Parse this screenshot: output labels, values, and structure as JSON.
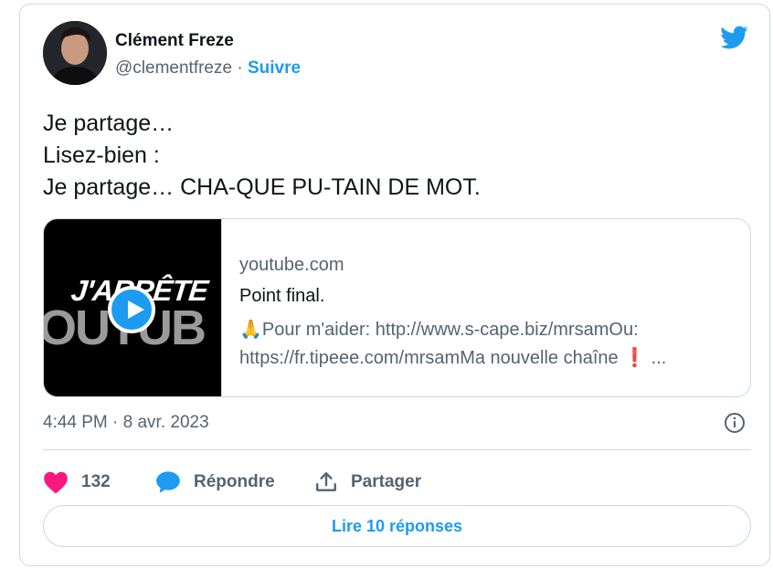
{
  "author": {
    "name": "Clément Freze",
    "handle": "@clementfreze",
    "separator": " · ",
    "follow_label": "Suivre"
  },
  "tweet": {
    "lines": [
      "Je partage…",
      "Lisez-bien :",
      "Je partage… CHA-QUE PU-TAIN DE MOT."
    ]
  },
  "link_card": {
    "thumbnail_text_top": "J'ARRÊTE",
    "thumbnail_text_bottom": "OUTUB",
    "domain": "youtube.com",
    "title": "Point final.",
    "description_line1": "🙏Pour m'aider: http://www.s-cape.biz/mrsamOu:",
    "description_line2": "https://fr.tipeee.com/mrsamMa nouvelle chaîne ❗ ..."
  },
  "meta": {
    "timestamp": "4:44 PM · 8 avr. 2023"
  },
  "actions": {
    "like_count": "132",
    "reply_label": "Répondre",
    "share_label": "Partager"
  },
  "replies_button": {
    "label": "Lire 10 réponses"
  },
  "colors": {
    "accent": "#1d9bf0",
    "like": "#f91880",
    "text_secondary": "#536471",
    "border": "#cfd9de"
  },
  "icons": [
    "twitter-bird-icon",
    "play-icon",
    "info-icon",
    "heart-icon",
    "reply-bubble-icon",
    "share-icon"
  ]
}
